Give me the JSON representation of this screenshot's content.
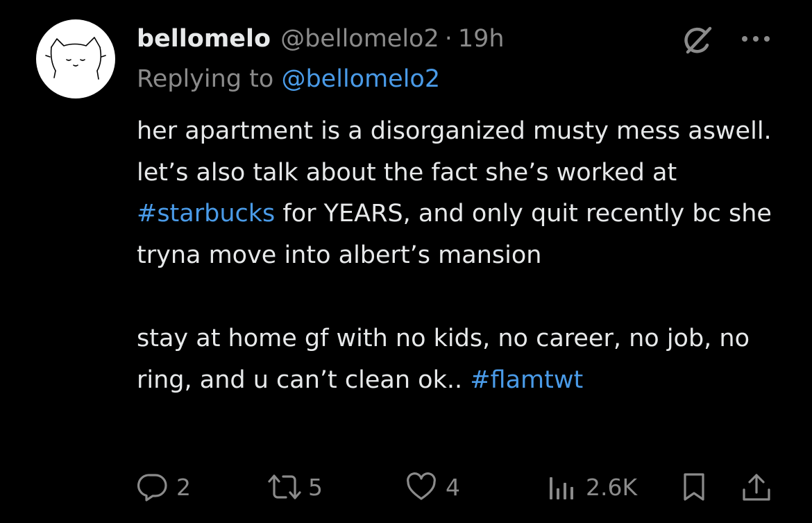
{
  "tweet": {
    "display_name": "bellomelo",
    "handle": "@bellomelo2",
    "separator": "·",
    "time": "19h",
    "replying_prefix": "Replying to",
    "replying_to": "@bellomelo2",
    "body_part1": "her apartment is a disorganized musty mess aswell. let’s also talk about the fact she’s worked at ",
    "hashtag1": "#starbucks",
    "body_part2": " for YEARS, and only quit recently bc she tryna move into albert’s mansion",
    "body_part3": "stay at home gf with no kids, no career, no job, no ring, and u can’t clean ok.. ",
    "hashtag2": "#flamtwt"
  },
  "actions": {
    "replies": "2",
    "reposts": "5",
    "likes": "4",
    "views": "2.6K"
  },
  "icons": {
    "avatar": "cat-doodle-avatar",
    "grok": "grok-icon",
    "more": "more-dots-icon",
    "reply": "reply-icon",
    "repost": "repost-icon",
    "like": "heart-icon",
    "views": "views-icon",
    "bookmark": "bookmark-icon",
    "share": "share-icon"
  },
  "colors": {
    "background": "#000000",
    "text": "#e7e9ea",
    "secondary": "#8b8b8b",
    "link": "#4a9be8"
  }
}
